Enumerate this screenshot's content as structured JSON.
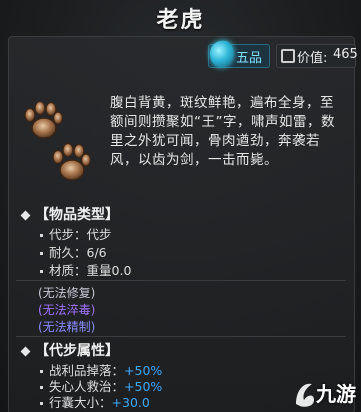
{
  "item": {
    "name": "老虎",
    "grade": "五品",
    "value_label": "价值:",
    "value": "465",
    "description": "腹白背黄，斑纹鲜艳，遍布全身，至额间则攒聚如“王”字，啸声如雷，数里之外犹可闻，骨肉遒劲，奔袭若风，以齿为剑，一击而毙。"
  },
  "type_section": {
    "header": "【物品类型】",
    "rows": [
      {
        "label": "代步：",
        "value": "代步"
      },
      {
        "label": "耐久：",
        "value": "6/6"
      },
      {
        "label": "材质：",
        "value": "重量0.0"
      }
    ]
  },
  "tags": [
    {
      "text": "(无法修复)",
      "color": "#c9c9d6"
    },
    {
      "text": "(无法淬毒)",
      "color": "#a173ff"
    },
    {
      "text": "(无法精制)",
      "color": "#8a8cff"
    }
  ],
  "attr_section": {
    "header": "【代步属性】",
    "rows": [
      {
        "label": "战利品掉落：",
        "value": "+50%"
      },
      {
        "label": "失心人救治：",
        "value": "+50%"
      },
      {
        "label": "行囊大小：",
        "value": "+30.0"
      }
    ]
  },
  "colors": {
    "grade": "#7fe3ff",
    "attr_value": "#3fa8ff",
    "background": "#1c1e20"
  },
  "icons": {
    "grade": "gem-icon",
    "value": "coin-icon",
    "item": "paw-prints-icon",
    "watermark": "jiuyou-logo-icon"
  },
  "watermark": {
    "text": "九游"
  }
}
